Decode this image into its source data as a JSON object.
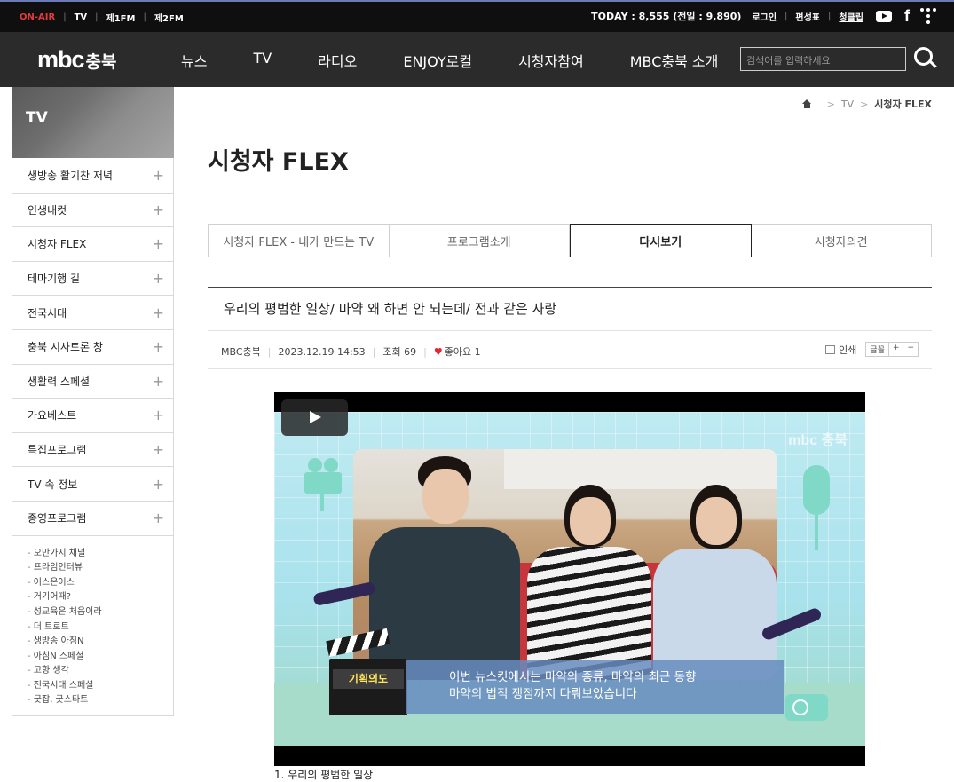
{
  "topbar": {
    "on_air": "ON-AIR",
    "channels": [
      "TV",
      "제1FM",
      "제2FM"
    ],
    "today": "TODAY : 8,555 (전일 : 9,890)",
    "links": [
      "로그인",
      "편성표",
      "청클립"
    ],
    "social_icons": [
      "youtube-icon",
      "facebook-icon",
      "dots-icon"
    ]
  },
  "nav": {
    "logo": "mbc",
    "logo_region": "충북",
    "menu": [
      "뉴스",
      "TV",
      "라디오",
      "ENJOY로컬",
      "시청자참여",
      "MBC충북 소개"
    ],
    "search_placeholder": "검색어를 입력하세요"
  },
  "sidebar": {
    "title": "TV",
    "items": [
      "생방송 활기찬 저녁",
      "인생내컷",
      "시청자 FLEX",
      "테마기행 길",
      "전국시대",
      "충북 시사토론 창",
      "생활력 스페셜",
      "가요베스트",
      "특집프로그램",
      "TV 속 정보",
      "종영프로그램"
    ],
    "sub_items": [
      "오만가지 채널",
      "프라임인터뷰",
      "어스온어스",
      "거기어때?",
      "성교육은 처음이라",
      "더 트로트",
      "생방송 아침N",
      "아침N 스페셜",
      "고향 생각",
      "전국시대 스페셜",
      "굿잡, 굿스타트"
    ]
  },
  "breadcrumb": {
    "items": [
      "TV",
      "시청자 FLEX"
    ]
  },
  "page": {
    "title": "시청자 FLEX",
    "tabs": [
      "시청자 FLEX - 내가 만드는 TV",
      "프로그램소개",
      "다시보기",
      "시청자의견"
    ],
    "active_tab": 2
  },
  "post": {
    "title": "우리의 평범한 일상/ 마약 왜 하면 안 되는데/ 전과 같은 사랑",
    "author": "MBC충북",
    "date": "2023.12.19 14:53",
    "views": "조회 69",
    "likes": "좋아요 1",
    "print_label": "인쇄",
    "font_label": "글꼴",
    "font_plus": "+",
    "font_minus": "−"
  },
  "video": {
    "watermark": "mbc 충북",
    "clapper_label": "기획의도",
    "caption_lines": [
      "이번 뉴스킷에서는 마약의 종류, 마약의 최근 동향",
      "마약의 법적 쟁점까지 다뤄보았습니다"
    ],
    "below_caption": "1. 우리의 평범한 일상"
  }
}
